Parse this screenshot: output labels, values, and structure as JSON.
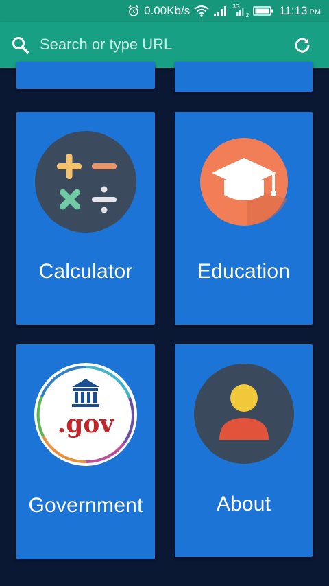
{
  "status_bar": {
    "network_speed": "0.00Kb/s",
    "network_type": "3G",
    "sim_slot": "2",
    "time": "11:13",
    "ampm": "PM",
    "icons": [
      "alarm-icon",
      "wifi-icon",
      "signal-icon",
      "signal-3g-icon",
      "battery-icon"
    ]
  },
  "search": {
    "placeholder": "Search or type URL",
    "icons": [
      "search-icon",
      "refresh-icon"
    ]
  },
  "tiles": [
    {
      "label": "Calculator",
      "icon": "calculator-icon"
    },
    {
      "label": "Education",
      "icon": "graduation-cap-icon"
    },
    {
      "label": "Government",
      "icon": "gov-seal-icon",
      "icon_text": ".gov"
    },
    {
      "label": "About",
      "icon": "user-profile-icon"
    }
  ],
  "colors": {
    "background": "#0b1833",
    "app_bar": "#18a084",
    "tile": "#1c74d6"
  }
}
